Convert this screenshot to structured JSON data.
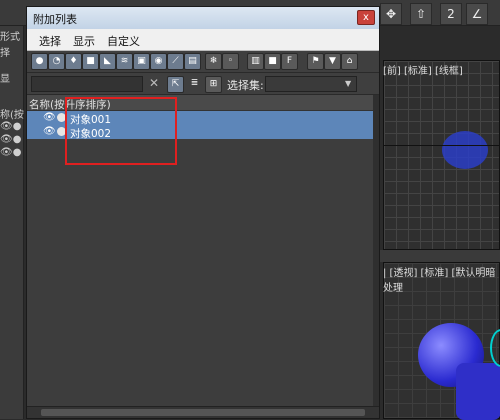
{
  "background": {
    "top_vp_label": "[前] [标准] [线框]",
    "persp_vp_label": "| [透视] [标准] [默认明暗处理",
    "left_texts": [
      "称(按",
      "形式",
      "择",
      "显"
    ]
  },
  "dialog": {
    "title": "附加列表",
    "close": "x",
    "menu": [
      "选择",
      "显示",
      "自定义"
    ],
    "toolbar2": {
      "selection_set_label": "选择集:",
      "selection_set_value": ""
    },
    "list": {
      "header": "名称(按升序排序)",
      "items": [
        "对象001",
        "对象002"
      ]
    }
  },
  "colors": {
    "selection": "#5d86b9",
    "highlight_box": "#e02020"
  }
}
